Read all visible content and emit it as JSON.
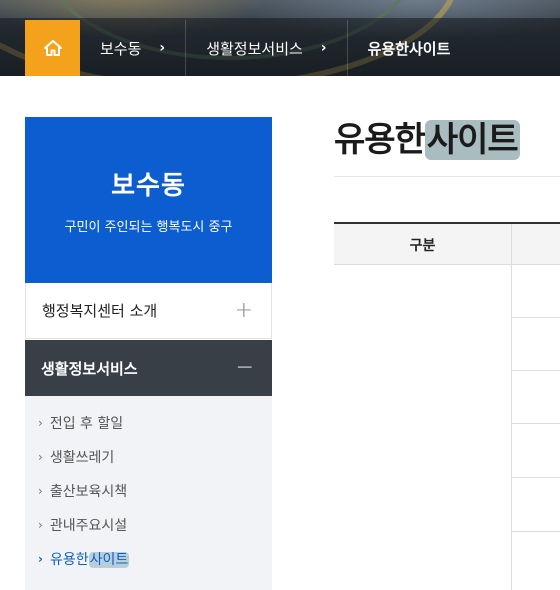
{
  "breadcrumb": {
    "home_icon": "home-icon",
    "items": [
      {
        "label": "보수동",
        "chevron": "›"
      },
      {
        "label": "생활정보서비스",
        "chevron": "›"
      },
      {
        "label": "유용한사이트"
      }
    ]
  },
  "sidebar": {
    "title": "보수동",
    "subtitle": "구민이 주인되는 행복도시 중구",
    "menu": [
      {
        "label": "행정복지센터 소개",
        "toggle": "+"
      },
      {
        "label": "생활정보서비스",
        "toggle": "−"
      }
    ],
    "submenu": [
      {
        "label": "전입 후 할일",
        "arrow": "›"
      },
      {
        "label": "생활쓰레기",
        "arrow": "›"
      },
      {
        "label": "출산보육시책",
        "arrow": "›"
      },
      {
        "label": "관내주요시설",
        "arrow": "›"
      },
      {
        "label_pre": "유용한",
        "label_hl": "사이트",
        "arrow": "›",
        "active": true
      }
    ]
  },
  "main": {
    "title_pre": "유용한",
    "title_hl": "사이트",
    "table": {
      "headers": [
        "구분"
      ]
    }
  },
  "colors": {
    "accent": "#0c5ed0",
    "home": "#f4a21c",
    "active_menu_bg": "#393f47"
  }
}
